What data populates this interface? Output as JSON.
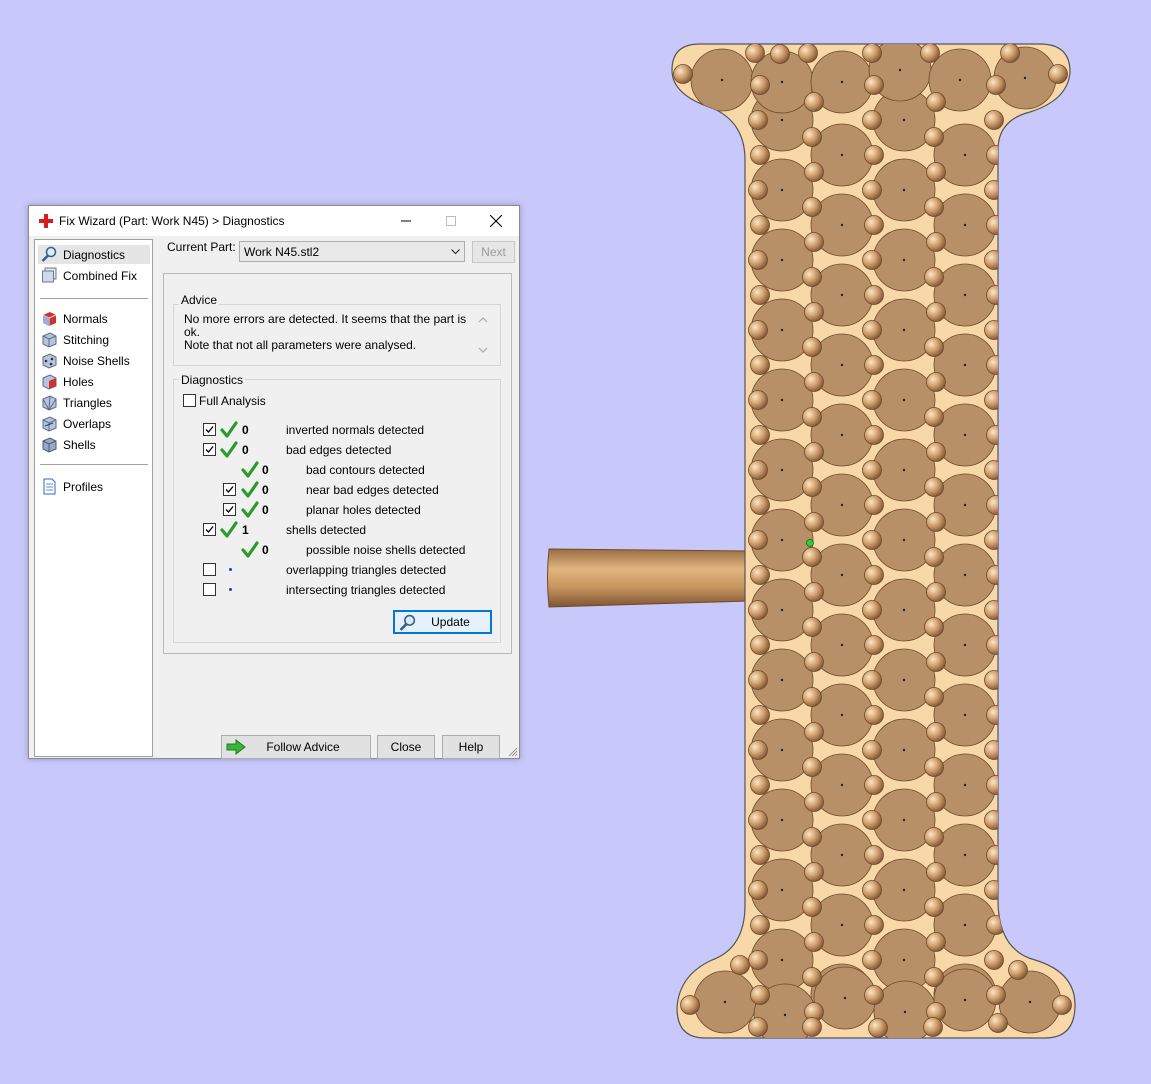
{
  "window": {
    "title": "Fix Wizard (Part: Work N45) > Diagnostics"
  },
  "nav": {
    "items": [
      {
        "label": "Diagnostics",
        "icon": "magnifier-icon",
        "selected": true
      },
      {
        "label": "Combined Fix",
        "icon": "combined-fix-icon"
      },
      {
        "label": "Normals",
        "icon": "normals-cube-icon"
      },
      {
        "label": "Stitching",
        "icon": "stitching-cube-icon"
      },
      {
        "label": "Noise Shells",
        "icon": "noise-shells-icon"
      },
      {
        "label": "Holes",
        "icon": "holes-cube-icon"
      },
      {
        "label": "Triangles",
        "icon": "triangles-cube-icon"
      },
      {
        "label": "Overlaps",
        "icon": "overlaps-cube-icon"
      },
      {
        "label": "Shells",
        "icon": "shells-cube-icon"
      },
      {
        "label": "Profiles",
        "icon": "document-icon"
      }
    ]
  },
  "current_part": {
    "label": "Current Part:",
    "value": "Work N45.stl2",
    "next_label": "Next"
  },
  "advice": {
    "title": "Advice",
    "line1": "No more errors are detected. It seems that the part is ok.",
    "line2": "Note that not all parameters were analysed."
  },
  "diagnostics": {
    "title": "Diagnostics",
    "full_analysis_label": "Full Analysis",
    "rows": [
      {
        "count": "0",
        "label": "inverted normals detected"
      },
      {
        "count": "0",
        "label": "bad edges detected"
      },
      {
        "count": "0",
        "label": "bad contours detected"
      },
      {
        "count": "0",
        "label": "near bad edges detected"
      },
      {
        "count": "0",
        "label": "planar holes detected"
      },
      {
        "count": "1",
        "label": "shells detected"
      },
      {
        "count": "0",
        "label": "possible noise shells detected"
      },
      {
        "count": "",
        "label": "overlapping triangles detected"
      },
      {
        "count": "",
        "label": "intersecting triangles detected"
      }
    ],
    "update_label": "Update"
  },
  "footer": {
    "follow_label": "Follow Advice",
    "close_label": "Close",
    "help_label": "Help"
  },
  "colors": {
    "background": "#c8c8fb",
    "part_fill": "#b89068",
    "check_green": "#2c9a2c",
    "focus_blue": "#0078d7"
  }
}
